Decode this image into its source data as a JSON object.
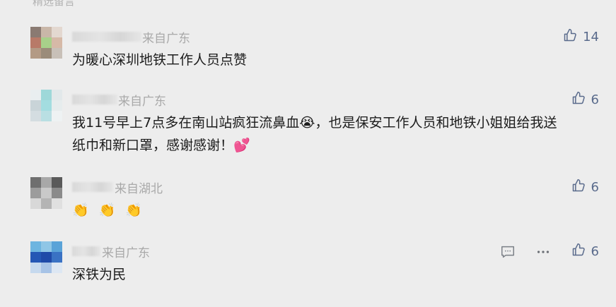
{
  "section": {
    "title": "精选留言"
  },
  "comments": [
    {
      "source": "来自广东",
      "text": "为暖心深圳地铁工作人员点赞",
      "likes": "14",
      "avatar_colors": [
        "#8a7a72",
        "#c9b7a8",
        "#e3d8d0",
        "#b87a68",
        "#a8d08a",
        "#d6b9a7",
        "#b39a85",
        "#9b8c7a",
        "#c8c0b8"
      ]
    },
    {
      "source": "来自广东",
      "text_line1_a": "我11号早上7点多在南山站疯狂流鼻血",
      "crying_emoji": "😭",
      "text_line1_b": "，也是保安工作人员和地铁小姐姐给我送",
      "text_line2": "纸巾和新口罩，感谢感谢！",
      "hearts": "💕",
      "likes": "6",
      "avatar_colors": [
        "#e9eef0",
        "#9ed8d9",
        "#e2e8ea",
        "#c9d4d8",
        "#a3dde0",
        "#e6eced",
        "#d4dde1",
        "#b9dfe3",
        "#eef2f3"
      ]
    },
    {
      "source": "来自湖北",
      "clap_emojis": [
        "👏",
        "👏",
        "👏"
      ],
      "likes": "6",
      "avatar_colors": [
        "#6f6f6f",
        "#a8a8a8",
        "#5a5a5a",
        "#9c9c9c",
        "#c9c9c9",
        "#8b8b8b",
        "#d8d8d8",
        "#b4b4b4",
        "#e0e0e0"
      ]
    },
    {
      "source": "来自广东",
      "text": "深铁为民",
      "likes": "6",
      "avatar_colors": [
        "#6db5e0",
        "#8fc6e6",
        "#5aa3d8",
        "#2457b5",
        "#1f4aa8",
        "#3a72c4",
        "#c6d9ee",
        "#a7c3e6",
        "#dde7f3"
      ]
    }
  ],
  "icons": {
    "like": "thumbs-up-icon",
    "reply": "comment-bubble-icon",
    "more": "more-dots-icon"
  },
  "colors": {
    "accent": "#5a6b8c",
    "background": "#ededed",
    "meta": "#a9a9a9"
  }
}
